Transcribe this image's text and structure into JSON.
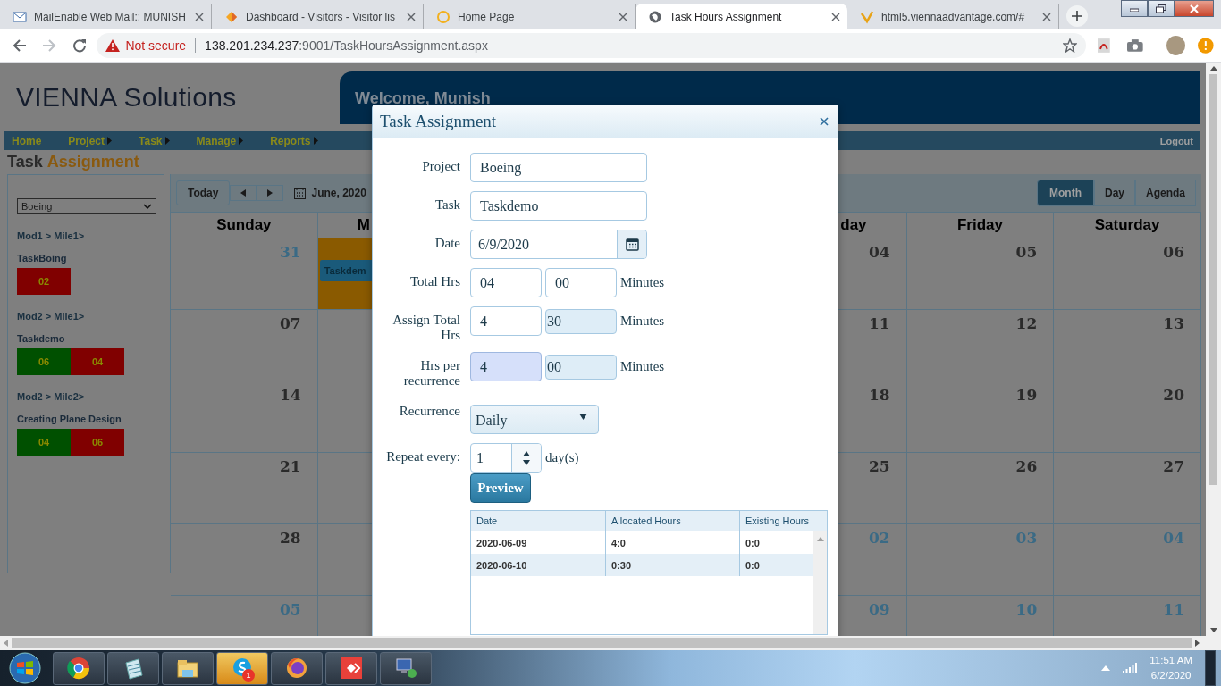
{
  "browser": {
    "tabs": [
      {
        "title": "MailEnable Web Mail:: MUNISH",
        "selected": false
      },
      {
        "title": "Dashboard - Visitors - Visitor lis",
        "selected": false
      },
      {
        "title": "Home Page",
        "selected": false
      },
      {
        "title": "Task Hours Assignment",
        "selected": true
      },
      {
        "title": "html5.viennaadvantage.com/#",
        "selected": false
      }
    ],
    "security": "Not secure",
    "url_host": "138.201.234.237",
    "url_rest": ":9001/TaskHoursAssignment.aspx"
  },
  "header": {
    "logo": "VIENNA Solutions",
    "welcome": "Welcome, Munish"
  },
  "nav": {
    "items": [
      {
        "label": "Home",
        "submenu": false
      },
      {
        "label": "Project",
        "submenu": true
      },
      {
        "label": "Task",
        "submenu": true
      },
      {
        "label": "Manage",
        "submenu": true
      },
      {
        "label": "Reports",
        "submenu": true
      }
    ],
    "logout": "Logout"
  },
  "title": {
    "lead": "Task",
    "accent": "Assignment"
  },
  "sidebar": {
    "project": "Boeing",
    "groups": [
      {
        "path": "Mod1 > Mile1>",
        "task": "TaskBoing",
        "boxes": [
          {
            "value": "02",
            "color": "#800000"
          }
        ]
      },
      {
        "path": "Mod2 > Mile1>",
        "task": "Taskdemo",
        "boxes": [
          {
            "value": "06",
            "color": "#005000"
          },
          {
            "value": "04",
            "color": "#800000"
          }
        ]
      },
      {
        "path": "Mod2 > Mile2>",
        "task": "Creating Plane Design",
        "boxes": [
          {
            "value": "04",
            "color": "#005000"
          },
          {
            "value": "06",
            "color": "#800000"
          }
        ]
      }
    ]
  },
  "calendar": {
    "today": "Today",
    "period": "June, 2020",
    "views": [
      {
        "label": "Month",
        "selected": true
      },
      {
        "label": "Day",
        "selected": false
      },
      {
        "label": "Agenda",
        "selected": false
      }
    ],
    "day_headers": {
      "sun": "Sunday",
      "mon": "M",
      "thu": "day",
      "fri": "Friday",
      "sat": "Saturday"
    },
    "weeks": [
      {
        "sun": {
          "date": "31",
          "other_month": true
        },
        "mon": {
          "highlighted": true,
          "event": "Taskdem"
        },
        "thu": {
          "date": "04",
          "other_month": false
        },
        "fri": {
          "date": "05",
          "other_month": false
        },
        "sat": {
          "date": "06",
          "other_month": false
        }
      },
      {
        "sun": {
          "date": "07",
          "other_month": false
        },
        "thu": {
          "date": "11",
          "other_month": false
        },
        "fri": {
          "date": "12",
          "other_month": false
        },
        "sat": {
          "date": "13",
          "other_month": false
        }
      },
      {
        "sun": {
          "date": "14",
          "other_month": false
        },
        "thu": {
          "date": "18",
          "other_month": false
        },
        "fri": {
          "date": "19",
          "other_month": false
        },
        "sat": {
          "date": "20",
          "other_month": false
        }
      },
      {
        "sun": {
          "date": "21",
          "other_month": false
        },
        "thu": {
          "date": "25",
          "other_month": false
        },
        "fri": {
          "date": "26",
          "other_month": false
        },
        "sat": {
          "date": "27",
          "other_month": false
        }
      },
      {
        "sun": {
          "date": "28",
          "other_month": false
        },
        "thu": {
          "date": "02",
          "other_month": true
        },
        "fri": {
          "date": "03",
          "other_month": true
        },
        "sat": {
          "date": "04",
          "other_month": true
        }
      },
      {
        "sun": {
          "date": "05",
          "other_month": true
        },
        "thu": {
          "date": "09",
          "other_month": true
        },
        "fri": {
          "date": "10",
          "other_month": true
        },
        "sat": {
          "date": "11",
          "other_month": true
        }
      }
    ]
  },
  "modal": {
    "title": "Task Assignment",
    "fields": [
      {
        "kind": "text",
        "label": "Project",
        "value": "Boeing"
      },
      {
        "kind": "text",
        "label": "Task",
        "value": "Taskdemo"
      },
      {
        "kind": "date",
        "label": "Date",
        "value": "6/9/2020"
      },
      {
        "kind": "hours",
        "label": "Total Hrs",
        "hours": "04",
        "minutes": "00",
        "unit": "Minutes",
        "hours_autofilled": false,
        "minutes_disabled": false
      },
      {
        "kind": "hours",
        "label": "Assign Total Hrs",
        "hours": "4",
        "minutes": "30",
        "unit": "Minutes",
        "hours_autofilled": false,
        "minutes_disabled": true
      },
      {
        "kind": "hours",
        "label": "Hrs per recurrence",
        "hours": "4",
        "minutes": "00",
        "unit": "Minutes",
        "hours_autofilled": true,
        "minutes_disabled": true
      },
      {
        "kind": "select",
        "label": "Recurrence",
        "value": "Daily"
      },
      {
        "kind": "spinner",
        "label": "Repeat every:",
        "value": "1",
        "unit": "day(s)"
      }
    ],
    "preview": "Preview",
    "table": {
      "columns": [
        "Date",
        "Allocated Hours",
        "Existing Hours"
      ],
      "rows": [
        [
          "2020-06-09",
          "4:0",
          "0:0"
        ],
        [
          "2020-06-10",
          "0:30",
          "0:0"
        ]
      ]
    }
  },
  "taskbar": {
    "buttons": [
      {
        "flashing": false
      },
      {
        "flashing": false
      },
      {
        "flashing": false
      },
      {
        "flashing": true,
        "badge": "1"
      },
      {
        "flashing": false
      },
      {
        "flashing": false
      },
      {
        "flashing": false
      }
    ],
    "time": "11:51 AM",
    "date": "6/2/2020"
  }
}
